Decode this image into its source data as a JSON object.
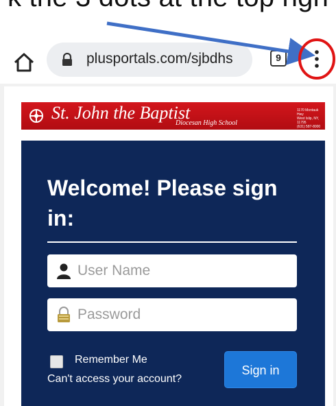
{
  "caption": {
    "text": "k the 3 dots at the top righ"
  },
  "browser": {
    "url": "plusportals.com/sjbdhs",
    "tab_count": "9",
    "icons": {
      "home": "home-icon",
      "lock": "lock-icon",
      "tabs": "tab-switcher-icon",
      "menu": "three-dot-menu-icon"
    }
  },
  "annotation": {
    "arrow_color": "#3f6fc6",
    "circle_color": "#e01414"
  },
  "banner": {
    "school_name": "St. John the Baptist",
    "school_subtitle": "Diocesan High School",
    "address_line1": "1170 Montauk Hwy",
    "address_line2": "West Islip, NY, 11795",
    "address_line3": "(631) 587-8000",
    "color": "#c8141a"
  },
  "login": {
    "heading": "Welcome! Please sign in:",
    "username_placeholder": "User Name",
    "password_placeholder": "Password",
    "remember_label": "Remember Me",
    "cant_access_label": "Can't access your account?",
    "signin_label": "Sign in",
    "panel_color": "#0e2758",
    "button_color": "#1d77d8"
  }
}
